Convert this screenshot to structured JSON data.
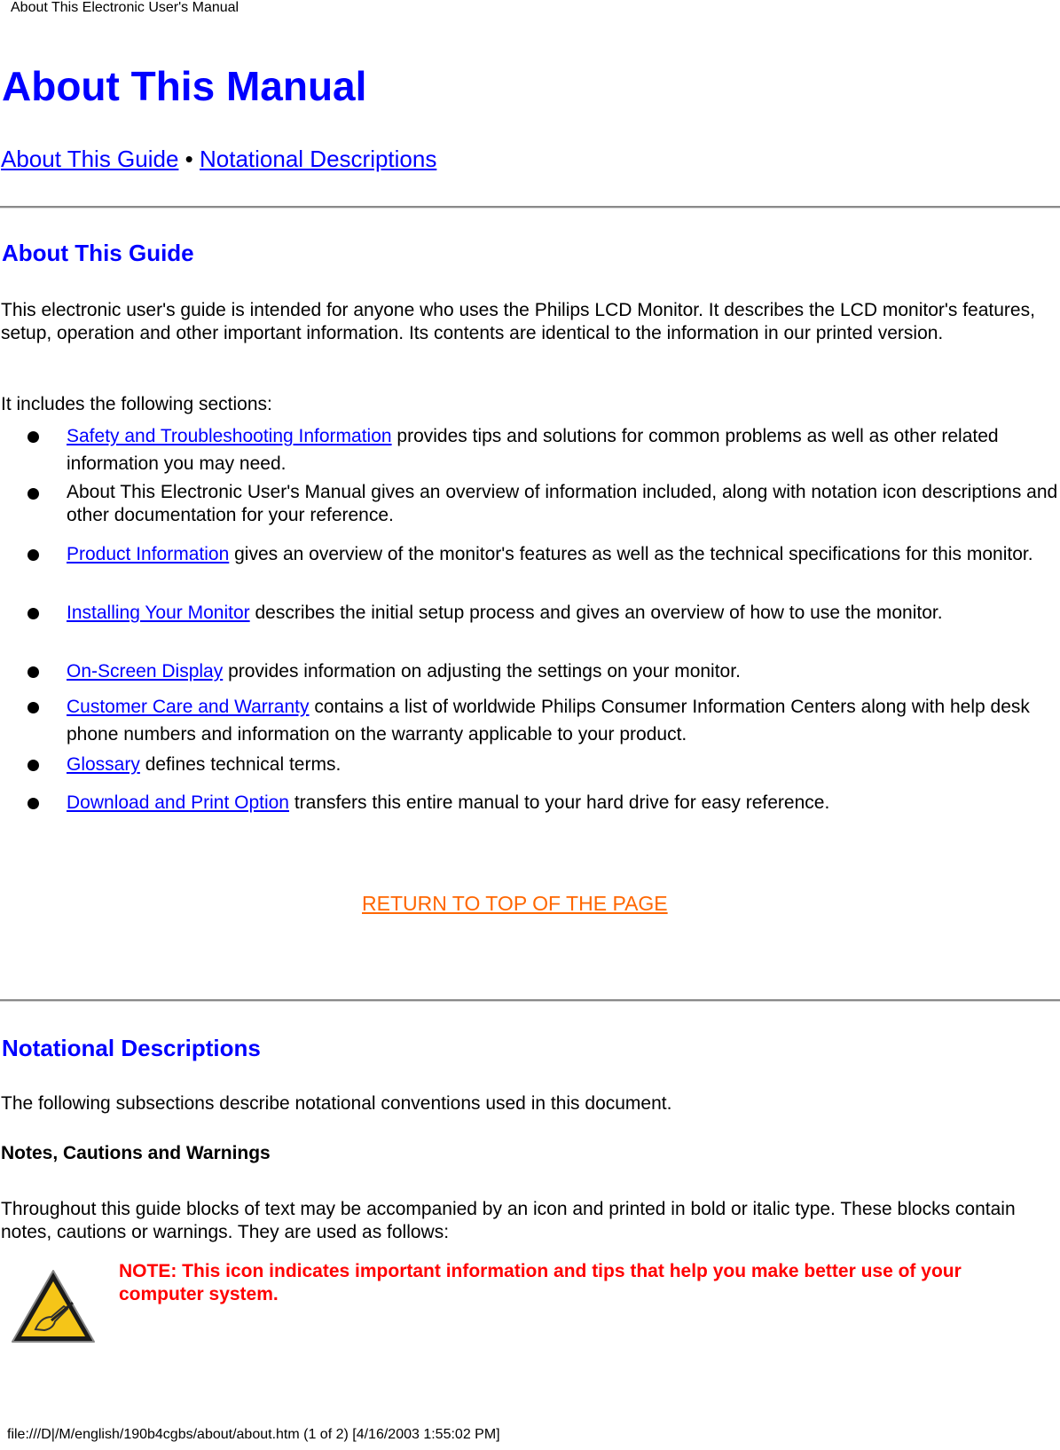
{
  "window_title": "About This Electronic User's Manual",
  "page_title": "About This Manual",
  "top_nav": {
    "links": [
      {
        "label": "About This Guide"
      },
      {
        "label": "Notational Descriptions"
      }
    ],
    "separator": "•"
  },
  "about_guide": {
    "heading": "About This Guide",
    "intro": "This electronic user's guide is intended for anyone who uses the Philips LCD Monitor. It describes the LCD monitor's features, setup, operation and other important information. Its contents are identical to the information in our printed version.",
    "includes_label": "It includes the following sections:",
    "sections": [
      {
        "link": "Safety and Troubleshooting Information",
        "text": " provides tips and solutions for common problems as well as other related information you may need."
      },
      {
        "link": "",
        "text": "About This Electronic User's Manual gives an overview of information included, along with notation icon descriptions and other documentation for your reference."
      },
      {
        "link": "Product Information",
        "text": " gives an overview of the monitor's features as well as the technical specifications for this monitor."
      },
      {
        "link": "Installing Your Monitor",
        "text": " describes the initial setup process and gives an overview of how to use the monitor."
      },
      {
        "link": "On-Screen Display",
        "text": " provides information on adjusting the settings on your monitor."
      },
      {
        "link": "Customer Care and Warranty",
        "text": " contains a list of worldwide Philips Consumer Information Centers along with help desk phone numbers and information on the warranty applicable to your product."
      },
      {
        "link": "Glossary",
        "text": " defines technical terms."
      },
      {
        "link": "Download and Print Option",
        "text": " transfers this entire manual to your hard drive for easy reference."
      }
    ],
    "return_link": "RETURN TO TOP OF THE PAGE"
  },
  "notational": {
    "heading": "Notational Descriptions",
    "intro": "The following subsections describe notational conventions used in this document.",
    "subheading": "Notes, Cautions and Warnings",
    "body": "Throughout this guide blocks of text may be accompanied by an icon and printed in bold or italic type. These blocks contain notes, cautions or warnings. They are used as follows:",
    "note": {
      "icon": "note-warning-triangle-icon",
      "text": "NOTE: This icon indicates important information and tips that help you make better use of your computer system."
    }
  },
  "footer": "file:///D|/M/english/190b4cgbs/about/about.htm (1 of 2) [4/16/2003 1:55:02 PM]",
  "colors": {
    "link": "#0000ff",
    "heading": "#0000ff",
    "return_link": "#ff6600",
    "note_text": "#ff0000"
  }
}
